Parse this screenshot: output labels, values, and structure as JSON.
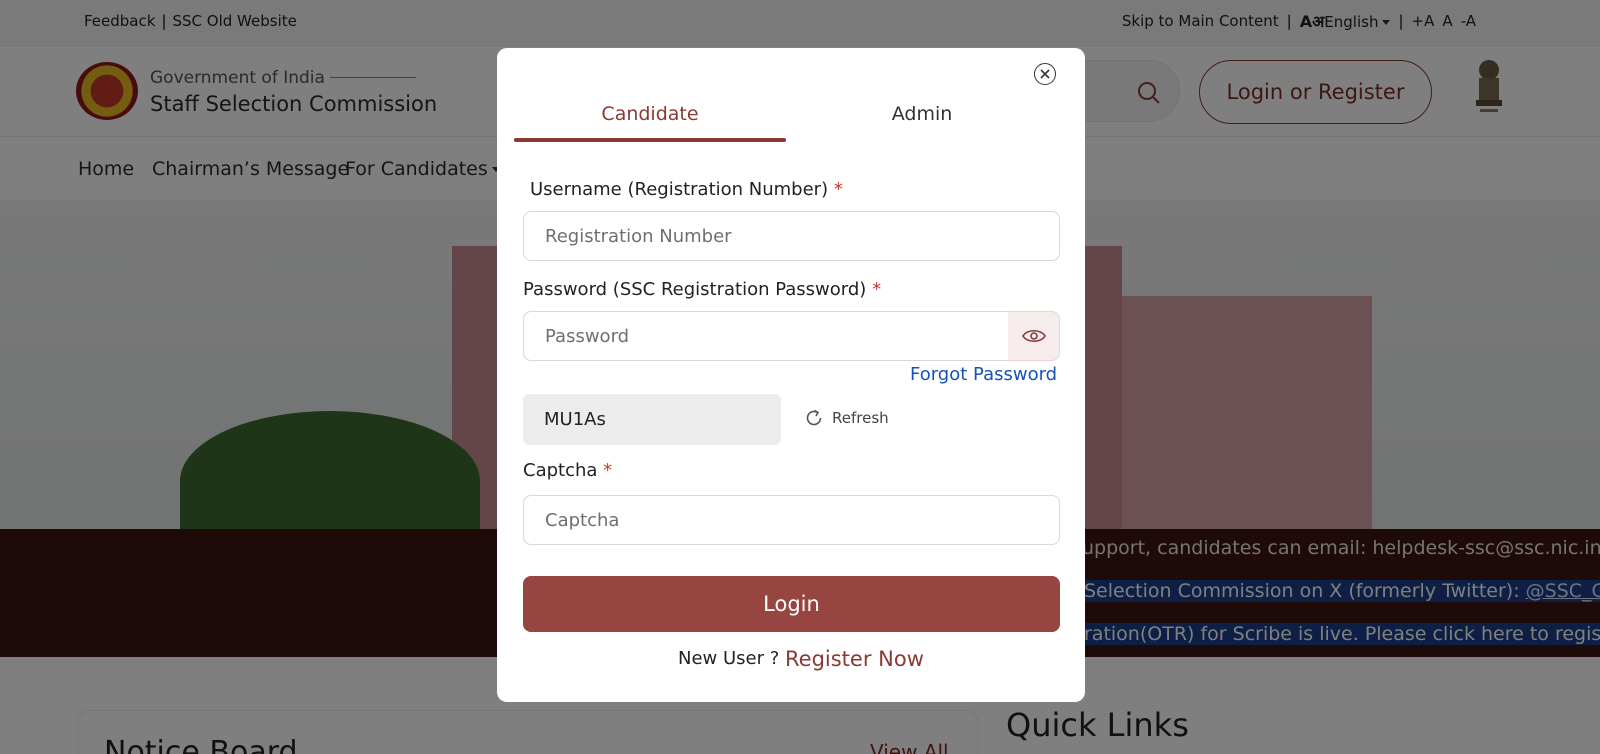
{
  "topbar": {
    "feedback": "Feedback",
    "old_website": "SSC Old Website",
    "skip": "Skip to Main Content",
    "lang_glyph": "Aअ",
    "language": "English",
    "font_increase": "+A",
    "font_normal": "A",
    "font_decrease": "-A"
  },
  "header": {
    "gov": "Government of India",
    "org": "Staff Selection Commission",
    "login_register": "Login or Register"
  },
  "nav": {
    "items": [
      "Home",
      "Chairman’s Message",
      "For Candidates"
    ]
  },
  "ticker": {
    "lines": [
      "upport, candidates can email: helpdesk-ssc@ssc.nic.in",
      "Selection Commission on X (formerly Twitter): ",
      "ration(OTR) for Scribe is live. Please click here to register."
    ],
    "twitter_handle": "@SSC_GoI"
  },
  "page": {
    "notice_board": "Notice Board",
    "view_all": "View All",
    "quick_links": "Quick Links"
  },
  "modal": {
    "tabs": [
      "Candidate",
      "Admin"
    ],
    "active_tab": "Candidate",
    "username_label": "Username (Registration Number)",
    "username_placeholder": "Registration Number",
    "password_label": "Password (SSC Registration Password)",
    "password_placeholder": "Password",
    "forgot_password": "Forgot Password",
    "captcha_code": "MU1As",
    "refresh": "Refresh",
    "captcha_label": "Captcha",
    "captcha_placeholder": "Captcha",
    "required_mark": "*",
    "login_button": "Login",
    "new_user": "New User ?",
    "register_now": "Register Now"
  },
  "colors": {
    "brand": "#8a3a32",
    "login_button": "#974540",
    "link": "#1452b8",
    "ticker_bg": "#3a1512"
  }
}
